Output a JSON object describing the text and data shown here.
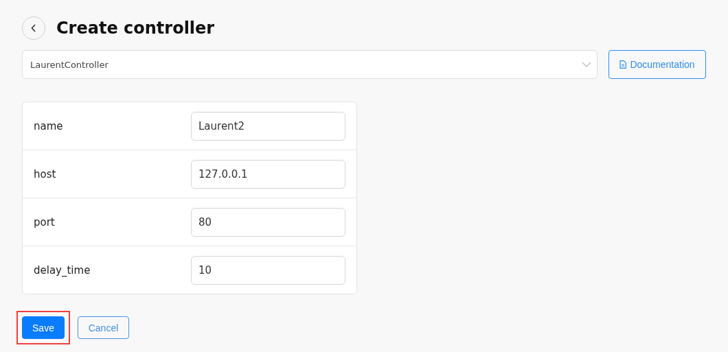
{
  "header": {
    "title": "Create controller"
  },
  "controller_select": {
    "value": "LaurentController"
  },
  "documentation_button": {
    "label": "Documentation"
  },
  "fields": [
    {
      "label": "name",
      "value": "Laurent2"
    },
    {
      "label": "host",
      "value": "127.0.0.1"
    },
    {
      "label": "port",
      "value": "80"
    },
    {
      "label": "delay_time",
      "value": "10"
    }
  ],
  "actions": [
    {
      "label": "Save",
      "kind": "primary",
      "highlighted": true
    },
    {
      "label": "Cancel",
      "kind": "secondary",
      "highlighted": false
    }
  ]
}
